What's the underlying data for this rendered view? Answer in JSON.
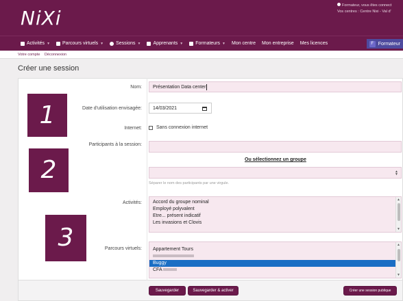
{
  "header": {
    "logo": "NiXi",
    "user_line1": "Formateur, vous êtes connect",
    "user_line2": "Vos centres : Centre Nixi - Val d'"
  },
  "nav": {
    "items": [
      {
        "label": "Activités",
        "icon": "activities-icon",
        "caret": true
      },
      {
        "label": "Parcours virtuels",
        "icon": "paths-icon",
        "caret": true
      },
      {
        "label": "Sessions",
        "icon": "sessions-icon",
        "caret": true
      },
      {
        "label": "Apprenants",
        "icon": "learners-icon",
        "caret": true
      },
      {
        "label": "Formateurs",
        "icon": "trainers-icon",
        "caret": true
      },
      {
        "label": "Mon centre",
        "icon": "",
        "caret": false
      },
      {
        "label": "Mon entreprise",
        "icon": "",
        "caret": false
      },
      {
        "label": "Mes licences",
        "icon": "",
        "caret": false
      }
    ],
    "user_badge": "F",
    "user_label": "Formateur"
  },
  "account": {
    "my_account": "Votre compte",
    "logout": "Déconnexion"
  },
  "page_title": "Créer une session",
  "form": {
    "name_label": "Nom:",
    "name_value": "Présentation Data center",
    "date_label": "Date d'utilisation envisagée:",
    "date_value": "14/03/2021",
    "internet_label": "Internet:",
    "internet_option": "Sans connexion internet",
    "participants_label": "Participants à la session:",
    "participants_value": "",
    "group_link": "Ou sélectionnez un groupe",
    "group_select_value": "",
    "participants_hint": "Séparer le nom des participants par une virgule.",
    "activities_label": "Activités:",
    "activities": [
      "Accord du groupe nominal",
      "Employé polyvalent",
      "Etre... présent indicatif",
      "Les invasions et Clovis"
    ],
    "paths_label": "Parcours virtuels:",
    "paths": [
      {
        "label": "Appartement Tours",
        "state": "normal"
      },
      {
        "label": "",
        "state": "blurred"
      },
      {
        "label": "Buggy",
        "state": "selected"
      },
      {
        "label": "CFA",
        "state": "normal"
      }
    ]
  },
  "annotations": [
    "1",
    "2",
    "3"
  ],
  "buttons": {
    "save": "Sauvegarder",
    "save_activate": "Sauvegarder & activer",
    "create_public": "Créer une session publique"
  }
}
